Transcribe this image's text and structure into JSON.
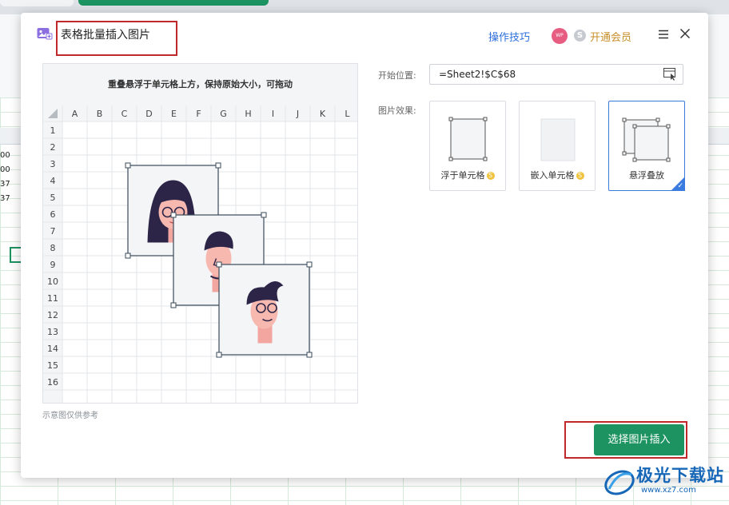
{
  "background": {
    "cell_values": [
      "00",
      "00",
      "37",
      "37"
    ]
  },
  "dialog": {
    "title": "表格批量插入图片",
    "tips_link": "操作技巧",
    "vip_avatar": "WP",
    "vip_coin": "S",
    "vip_label": "开通会员",
    "menu_icon": "hamburger-menu-icon",
    "close_icon": "close-x-icon",
    "accent_color": "#1d9361",
    "highlight_color": "#c0282a"
  },
  "preview": {
    "caption_title": "重叠悬浮于单元格上方，保持原始大小，可拖动",
    "columns": [
      "A",
      "B",
      "C",
      "D",
      "E",
      "F",
      "G",
      "H",
      "I",
      "J",
      "K",
      "L"
    ],
    "rows": [
      "1",
      "2",
      "3",
      "4",
      "5",
      "6",
      "7",
      "8",
      "9",
      "10",
      "11",
      "12",
      "13",
      "14",
      "15",
      "16"
    ],
    "footnote": "示意图仅供参考"
  },
  "settings": {
    "start_position_label": "开始位置:",
    "start_position_value": "=Sheet2!$C$68",
    "effect_label": "图片效果:",
    "options": [
      {
        "label": "浮于单元格",
        "paid": true,
        "selected": false
      },
      {
        "label": "嵌入单元格",
        "paid": true,
        "selected": false
      },
      {
        "label": "悬浮叠放",
        "paid": false,
        "selected": true
      }
    ],
    "paid_mark": "S",
    "selected_mark": "✓"
  },
  "actions": {
    "insert_button": "选择图片插入"
  },
  "watermark": {
    "text": "极光下载站",
    "url": "www.xz7.com"
  }
}
